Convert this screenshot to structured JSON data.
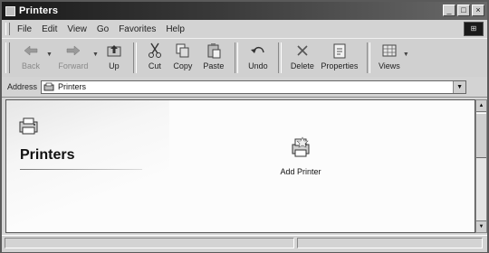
{
  "window": {
    "title": "Printers"
  },
  "menu": [
    "File",
    "Edit",
    "View",
    "Go",
    "Favorites",
    "Help"
  ],
  "toolbar": {
    "back": "Back",
    "forward": "Forward",
    "up": "Up",
    "cut": "Cut",
    "copy": "Copy",
    "paste": "Paste",
    "undo": "Undo",
    "delete": "Delete",
    "properties": "Properties",
    "views": "Views"
  },
  "address": {
    "label": "Address",
    "value": "Printers"
  },
  "panel": {
    "title": "Printers"
  },
  "items": [
    {
      "label": "Add Printer",
      "icon": "add-printer-icon"
    }
  ],
  "icons": {
    "folder": "printer-folder-icon",
    "address": "printers-address-icon"
  },
  "colors": {
    "titlebar": "#1a1a1a",
    "content_bg": "#fcfcfc",
    "chrome": "#d3d3d3"
  }
}
